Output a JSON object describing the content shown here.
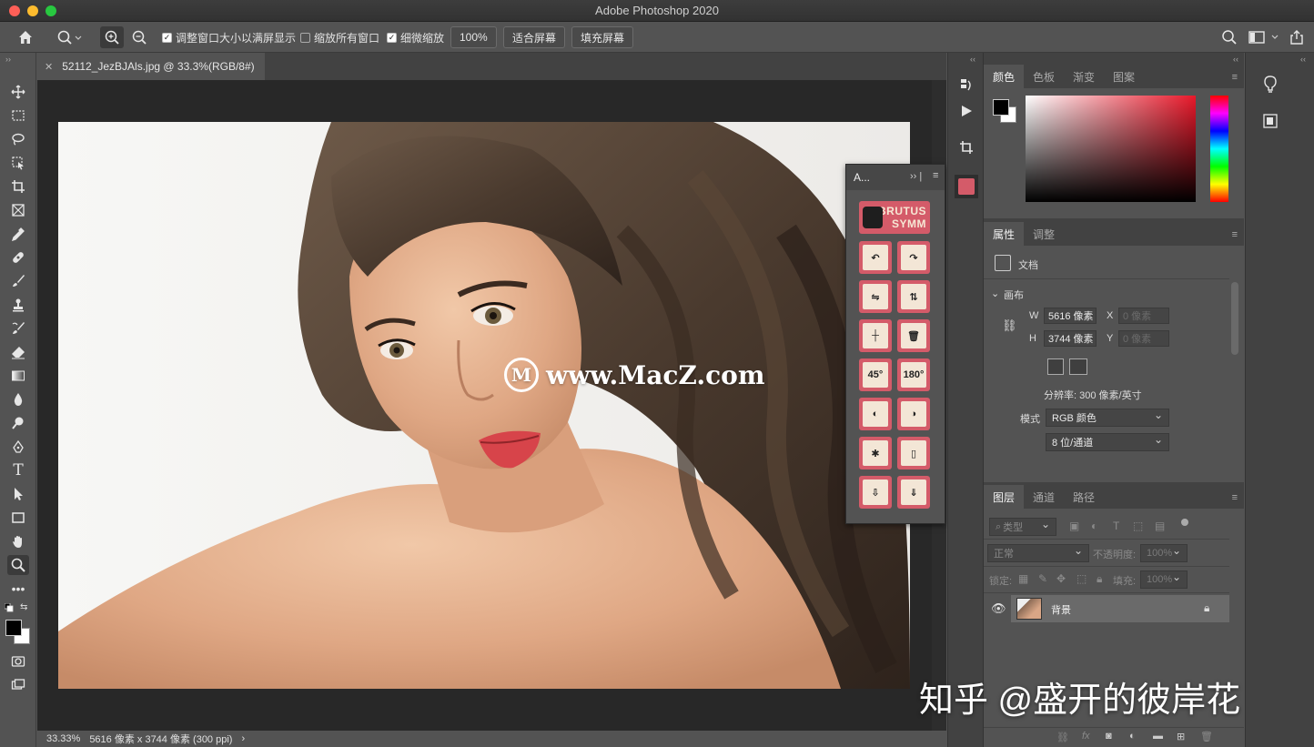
{
  "window": {
    "title": "Adobe Photoshop 2020"
  },
  "options_bar": {
    "resize_windows_label": "调整窗口大小以满屏显示",
    "zoom_all_windows_label": "缩放所有窗口",
    "scrubby_zoom_label": "细微缩放",
    "zoom_100_label": "100%",
    "fit_screen_label": "适合屏幕",
    "fill_screen_label": "填充屏幕",
    "resize_windows_checked": true,
    "zoom_all_windows_checked": false,
    "scrubby_zoom_checked": true
  },
  "document": {
    "tab_title": "52112_JezBJAls.jpg @ 33.3%(RGB/8#)",
    "zoom": "33.33%",
    "info": "5616 像素 x 3744 像素 (300 ppi)",
    "info_arrow": "›"
  },
  "actions_panel": {
    "title": "A...",
    "brand_line1": "BRUTUS",
    "brand_line2": "SYMM"
  },
  "color_panel": {
    "tabs": [
      "颜色",
      "色板",
      "渐变",
      "图案"
    ],
    "foreground": "#000000",
    "background": "#ffffff",
    "hue_color": "#e8182a"
  },
  "properties_panel": {
    "tabs": [
      "属性",
      "调整"
    ],
    "doc_label": "文档",
    "section": "画布",
    "w_label": "W",
    "w_value": "5616 像素",
    "h_label": "H",
    "h_value": "3744 像素",
    "x_label": "X",
    "x_placeholder": "0 像素",
    "y_label": "Y",
    "y_placeholder": "0 像素",
    "resolution": "分辨率: 300 像素/英寸",
    "mode_label": "模式",
    "mode_value": "RGB 颜色",
    "depth_value": "8 位/通道"
  },
  "layers_panel": {
    "tabs": [
      "图层",
      "通道",
      "路径"
    ],
    "filter_label": "类型",
    "blend_mode": "正常",
    "opacity_label": "不透明度:",
    "opacity_value": "100%",
    "lock_label": "锁定:",
    "fill_label": "填充:",
    "fill_value": "100%",
    "layers": [
      {
        "name": "背景"
      }
    ]
  },
  "watermarks": {
    "center": "www.MacZ.com",
    "logo_letter": "M",
    "bottom": "知乎 @盛开的彼岸花"
  }
}
